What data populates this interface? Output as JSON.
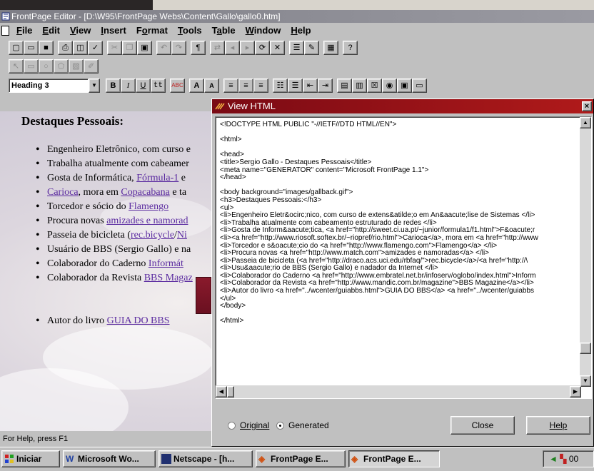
{
  "window": {
    "title": "FrontPage Editor - [D:\\W95\\FrontPage Webs\\Content\\Gallo\\gallo0.htm]"
  },
  "menu": [
    {
      "label": "File",
      "key": "F",
      "rest": "ile"
    },
    {
      "label": "Edit",
      "key": "E",
      "rest": "dit"
    },
    {
      "label": "View",
      "key": "V",
      "rest": "iew"
    },
    {
      "label": "Insert",
      "key": "I",
      "rest": "nsert"
    },
    {
      "label": "Format",
      "key": "o",
      "pre": "F",
      "rest": "rmat"
    },
    {
      "label": "Tools",
      "key": "T",
      "rest": "ools"
    },
    {
      "label": "Table",
      "key": "a",
      "pre": "T",
      "rest": "ble"
    },
    {
      "label": "Window",
      "key": "W",
      "rest": "indow"
    },
    {
      "label": "Help",
      "key": "H",
      "rest": "elp"
    }
  ],
  "format_toolbar": {
    "style_value": "Heading 3"
  },
  "document": {
    "heading": "Destaques Pessoais:",
    "items": [
      {
        "parts": [
          {
            "t": "Engenheiro Eletrônico, com curso e"
          }
        ]
      },
      {
        "parts": [
          {
            "t": "Trabalha atualmente com cabeamer"
          }
        ]
      },
      {
        "parts": [
          {
            "t": "Gosta de Informática, "
          },
          {
            "t": "Fórmula-1",
            "link": true
          },
          {
            "t": " e"
          }
        ]
      },
      {
        "parts": [
          {
            "t": "Carioca",
            "link": true
          },
          {
            "t": ", mora em "
          },
          {
            "t": "Copacabana",
            "link": true
          },
          {
            "t": " e ta"
          }
        ]
      },
      {
        "parts": [
          {
            "t": "Torcedor e sócio do "
          },
          {
            "t": "Flamengo",
            "link": true
          }
        ]
      },
      {
        "parts": [
          {
            "t": "Procura novas "
          },
          {
            "t": "amizades e namorad",
            "link": true
          }
        ]
      },
      {
        "parts": [
          {
            "t": "Passeia de bicicleta ("
          },
          {
            "t": "rec.bicycle",
            "link": true
          },
          {
            "t": "/"
          },
          {
            "t": "Ni",
            "link": true
          }
        ]
      },
      {
        "parts": [
          {
            "t": "Usuário de BBS (Sergio Gallo) e na"
          }
        ]
      },
      {
        "parts": [
          {
            "t": "Colaborador do Caderno "
          },
          {
            "t": "Informát",
            "link": true
          }
        ]
      },
      {
        "parts": [
          {
            "t": "Colaborador da Revista "
          },
          {
            "t": "BBS Magaz",
            "link": true
          }
        ]
      },
      {
        "gap": true
      },
      {
        "gap": true
      },
      {
        "parts": [
          {
            "t": "Autor do livro "
          },
          {
            "t": "GUIA DO BBS",
            "link": true
          }
        ]
      }
    ]
  },
  "status": "For Help, press F1",
  "view_html": {
    "title": "View HTML",
    "lines": [
      "<!DOCTYPE HTML PUBLIC \"-//IETF//DTD HTML//EN\">",
      "",
      "<html>",
      "",
      "<head>",
      "<title>Sergio Gallo - Destaques Pessoais</title>",
      "<meta name=\"GENERATOR\" content=\"Microsoft FrontPage 1.1\">",
      "</head>",
      "",
      "<body background=\"images/gallback.gif\">",
      "<h3>Destaques Pessoais:</h3>",
      "<ul>",
      "<li>Engenheiro Eletr&ocirc;nico, com curso de extens&atilde;o em An&aacute;lise de Sistemas </li>",
      "<li>Trabalha atualmente com cabeamento estruturado de redes </li>",
      "<li>Gosta de Inform&aacute;tica, <a href=\"http://sweet.ci.ua.pt/~junior/formula1/f1.html\">F&oacute;r",
      "<li><a href=\"http://www.riosoft.softex.br/~riopref/rio.html\">Carioca</a>, mora em <a href=\"http://www",
      "<li>Torcedor e s&oacute;cio do <a href=\"http://www.flamengo.com\">Flamengo</a> </li>",
      "<li>Procura novas <a href=\"http://www.match.com\">amizades e namoradas</a> </li>",
      "<li>Passeia de bicicleta (<a href=\"http://draco.acs.uci.edu/rbfaq/\">rec.bicycle</a>/<a href=\"http://\\",
      "<li>Usu&aacute;rio de BBS (Sergio Gallo) e nadador da Internet </li>",
      "<li>Colaborador do Caderno <a href=\"http://www.embratel.net.br/infoserv/oglobo/index.html\">Inform",
      "<li>Colaborador da Revista <a href=\"http://www.mandic.com.br/magazine\">BBS Magazine</a></li>",
      "<li>Autor do livro <a href=\"../wcenter/guiabbs.html\">GUIA DO BBS</a> <a href=\"../wcenter/guiabbs",
      "</ul>",
      "</body>",
      "",
      "</html>"
    ],
    "radio_original": "Original",
    "radio_generated": "Generated",
    "selected": "Generated",
    "close_label": "Close",
    "help_label": "Help"
  },
  "taskbar": {
    "start_label": "Iniciar",
    "tasks": [
      "Microsoft Wo...",
      "Netscape - [h...",
      "FrontPage E...",
      "FrontPage E..."
    ],
    "active_task": 3,
    "clock": "00"
  },
  "colors": {
    "link": "#5b2ba0",
    "dialog_title": "#8a0e18",
    "main_title": "#8a8a92",
    "chrome": "#c0c0c0"
  }
}
